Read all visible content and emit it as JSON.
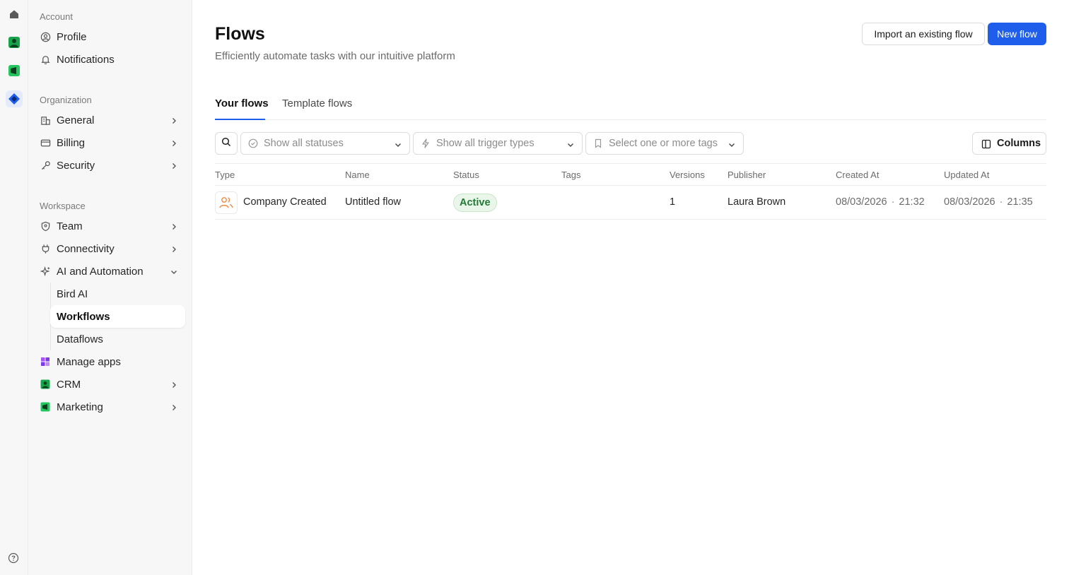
{
  "rail": {
    "icons": [
      "home-icon",
      "crm-app-icon",
      "marketing-app-icon",
      "bird-logo-icon"
    ],
    "help_icon": "help-circle-icon"
  },
  "sidebar": {
    "account_label": "Account",
    "account_items": [
      {
        "label": "Profile",
        "icon": "user-circle-icon"
      },
      {
        "label": "Notifications",
        "icon": "bell-icon"
      }
    ],
    "organization_label": "Organization",
    "organization_items": [
      {
        "label": "General",
        "icon": "building-icon"
      },
      {
        "label": "Billing",
        "icon": "credit-card-icon"
      },
      {
        "label": "Security",
        "icon": "key-icon"
      }
    ],
    "workspace_label": "Workspace",
    "workspace_items": [
      {
        "label": "Team",
        "icon": "shield-icon"
      },
      {
        "label": "Connectivity",
        "icon": "plug-icon"
      },
      {
        "label": "AI and Automation",
        "icon": "sparkle-icon"
      }
    ],
    "ai_sub_items": [
      {
        "label": "Bird AI"
      },
      {
        "label": "Workflows",
        "active": true
      },
      {
        "label": "Dataflows"
      }
    ],
    "app_items": [
      {
        "label": "Manage apps",
        "icon": "apps-grid-icon"
      },
      {
        "label": "CRM",
        "icon": "crm-app-icon"
      },
      {
        "label": "Marketing",
        "icon": "marketing-app-icon"
      }
    ]
  },
  "header": {
    "title": "Flows",
    "subtitle": "Efficiently automate tasks with our intuitive platform",
    "import_label": "Import an existing flow",
    "new_label": "New flow"
  },
  "tabs": [
    {
      "label": "Your flows",
      "active": true
    },
    {
      "label": "Template flows",
      "active": false
    }
  ],
  "filters": {
    "status_placeholder": "Show all statuses",
    "trigger_placeholder": "Show all trigger types",
    "tags_placeholder": "Select one or more tags",
    "columns_label": "Columns"
  },
  "table": {
    "columns": [
      "Type",
      "Name",
      "Status",
      "Tags",
      "Versions",
      "Publisher",
      "Created At",
      "Updated At"
    ],
    "rows": [
      {
        "type": "Company Created",
        "name": "Untitled flow",
        "status": "Active",
        "tags": "",
        "versions": "1",
        "publisher": "Laura Brown",
        "created_date": "08/03/2026",
        "created_time": "21:32",
        "updated_date": "08/03/2026",
        "updated_time": "21:35"
      }
    ]
  },
  "colors": {
    "accent": "#1f5eea",
    "status_active_bg": "#eaf6ea",
    "status_active_text": "#237a34",
    "crm_green": "#16a34a",
    "type_icon_orange": "#f0883e"
  },
  "separator": "·"
}
